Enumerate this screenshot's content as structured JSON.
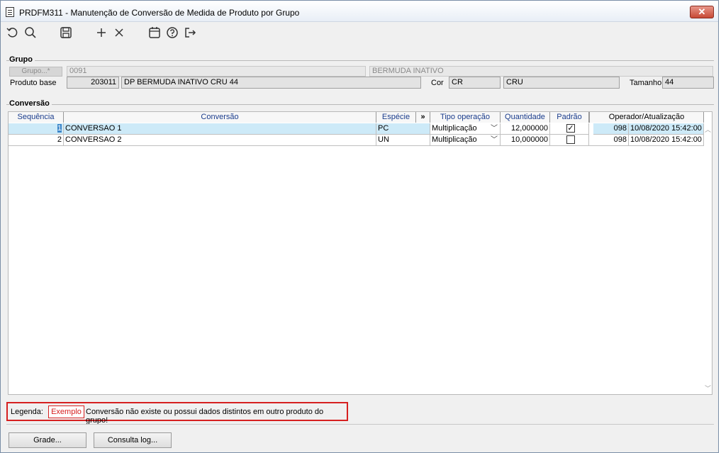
{
  "window": {
    "title": "PRDFM311 - Manutenção de Conversão de Medida de Produto por Grupo",
    "close": "✕"
  },
  "toolbar": {
    "icons": [
      "undo-icon",
      "search-icon",
      "save-icon",
      "add-icon",
      "delete-icon",
      "calendar-icon",
      "help-icon",
      "exit-icon"
    ]
  },
  "grupo": {
    "section_label": "Grupo",
    "grupo_button": "Grupo...*",
    "grupo_code": "0091",
    "grupo_desc": "BERMUDA INATIVO",
    "produto_base_label": "Produto base",
    "produto_base_code": "203011",
    "produto_base_desc": "DP BERMUDA INATIVO CRU 44",
    "cor_label": "Cor",
    "cor_code": "CR",
    "cor_desc": "CRU",
    "tamanho_label": "Tamanho",
    "tamanho_value": "44"
  },
  "conversao": {
    "section_label": "Conversão",
    "columns": {
      "sequencia": "Sequência",
      "conversao": "Conversão",
      "especie": "Espécie",
      "expand": "»",
      "tipo_operacao": "Tipo operação",
      "quantidade": "Quantidade",
      "padrao": "Padrão",
      "operador": "Operador/Atualização"
    },
    "rows": [
      {
        "seq": "1",
        "conversao": "CONVERSAO 1",
        "especie": "PC",
        "tipo": "Multiplicação",
        "quantidade": "12,000000",
        "padrao": "✓",
        "operador": "098",
        "atualizacao": "10/08/2020 15:42:00"
      },
      {
        "seq": "2",
        "conversao": "CONVERSAO 2",
        "especie": "UN",
        "tipo": "Multiplicação",
        "quantidade": "10,000000",
        "padrao": "",
        "operador": "098",
        "atualizacao": "10/08/2020 15:42:00"
      }
    ]
  },
  "legenda": {
    "label": "Legenda:",
    "example": "Exemplo",
    "text": "Conversão não existe ou possui dados distintos em outro produto do grupo!"
  },
  "buttons": {
    "grade": "Grade...",
    "consulta_log": "Consulta log..."
  },
  "colors": {
    "selected_row": "#cdeaf8",
    "header_text": "#1a3c8c",
    "legend_border": "#d62020"
  }
}
